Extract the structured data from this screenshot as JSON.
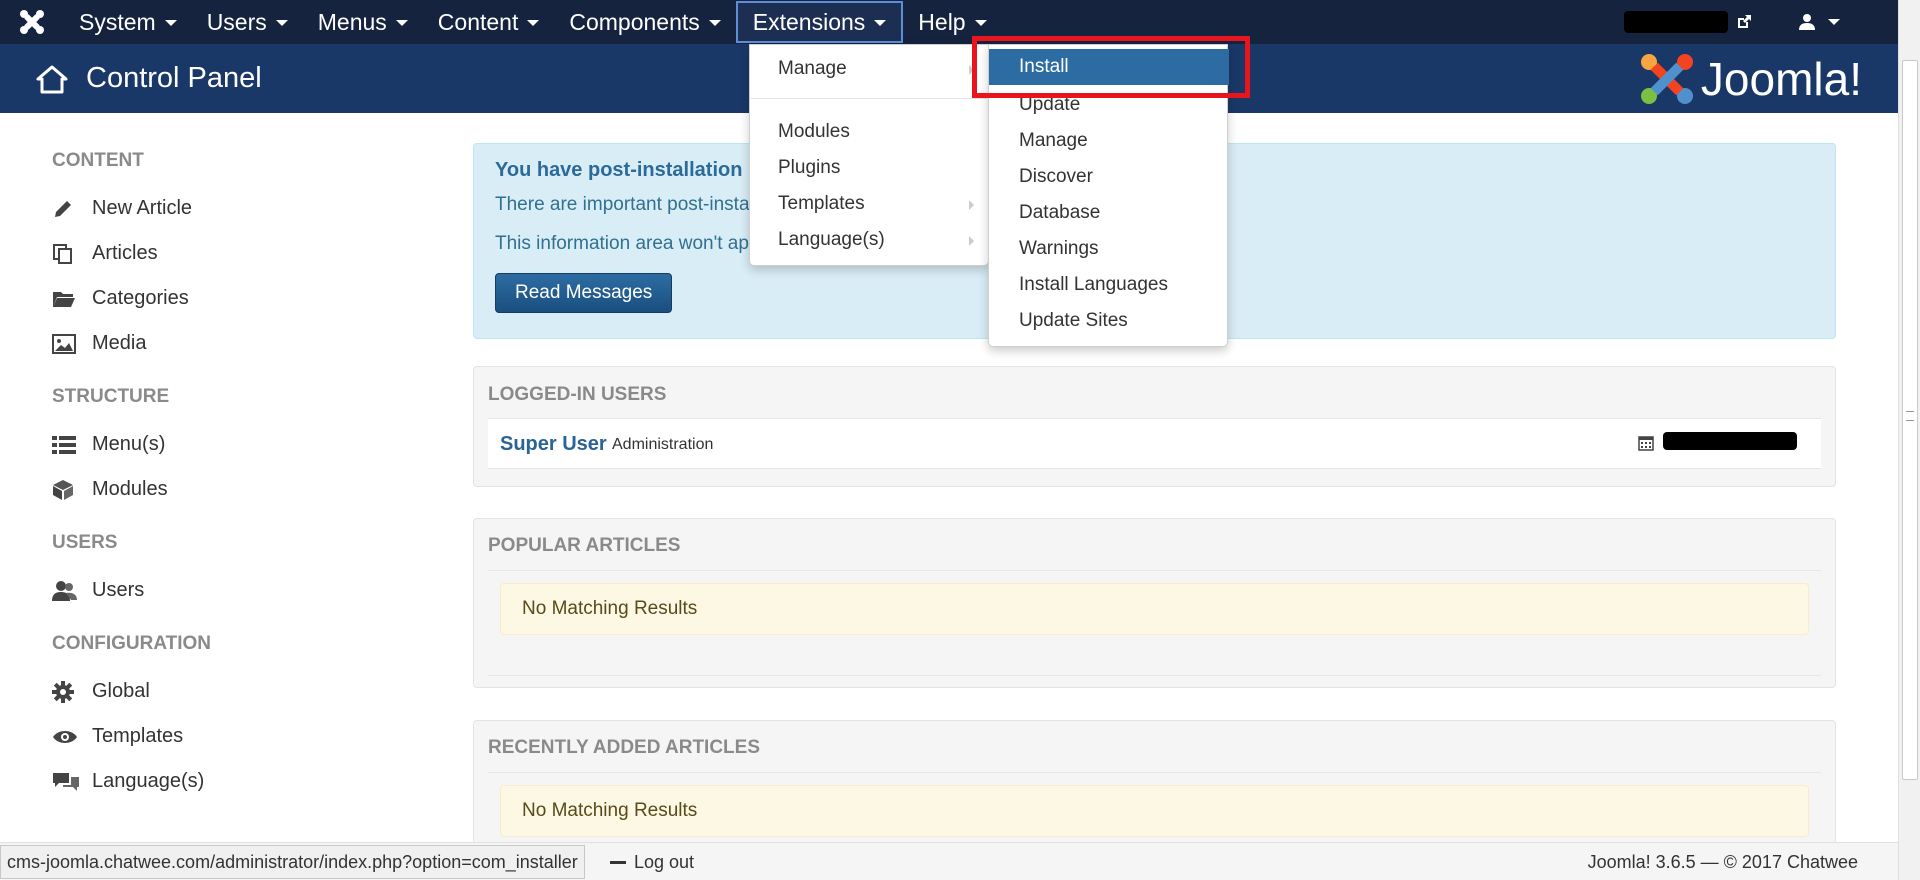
{
  "navbar": {
    "items": [
      {
        "label": "System"
      },
      {
        "label": "Users"
      },
      {
        "label": "Menus"
      },
      {
        "label": "Content"
      },
      {
        "label": "Components"
      },
      {
        "label": "Extensions"
      },
      {
        "label": "Help"
      }
    ],
    "active_item": "Extensions",
    "user_icon": "user-icon",
    "external_link_icon": "external-link-icon"
  },
  "header": {
    "title": "Control Panel",
    "brand": "Joomla!",
    "home_icon": "home-icon"
  },
  "extensions_menu": {
    "items": [
      {
        "label": "Manage",
        "has_submenu": true
      },
      {
        "label": "Modules",
        "has_submenu": false
      },
      {
        "label": "Plugins",
        "has_submenu": false
      },
      {
        "label": "Templates",
        "has_submenu": true
      },
      {
        "label": "Language(s)",
        "has_submenu": true
      }
    ]
  },
  "manage_submenu": {
    "items": [
      {
        "label": "Install",
        "active": true
      },
      {
        "label": "Update"
      },
      {
        "label": "Manage"
      },
      {
        "label": "Discover"
      },
      {
        "label": "Database"
      },
      {
        "label": "Warnings"
      },
      {
        "label": "Install Languages"
      },
      {
        "label": "Update Sites"
      }
    ]
  },
  "sidebar": {
    "groups": [
      {
        "heading": "CONTENT",
        "items": [
          {
            "label": "New Article",
            "icon": "pencil-icon"
          },
          {
            "label": "Articles",
            "icon": "copy-icon"
          },
          {
            "label": "Categories",
            "icon": "folder-icon"
          },
          {
            "label": "Media",
            "icon": "image-icon"
          }
        ]
      },
      {
        "heading": "STRUCTURE",
        "items": [
          {
            "label": "Menu(s)",
            "icon": "list-icon"
          },
          {
            "label": "Modules",
            "icon": "cube-icon"
          }
        ]
      },
      {
        "heading": "USERS",
        "items": [
          {
            "label": "Users",
            "icon": "users-icon"
          }
        ]
      },
      {
        "heading": "CONFIGURATION",
        "items": [
          {
            "label": "Global",
            "icon": "gear-icon"
          },
          {
            "label": "Templates",
            "icon": "eye-icon"
          },
          {
            "label": "Language(s)",
            "icon": "comments-icon"
          }
        ]
      }
    ]
  },
  "alert": {
    "title": "You have post-installation",
    "line1": "There are important post-insta",
    "line2": "This information area won't ap",
    "button": "Read Messages"
  },
  "logged_in_users": {
    "title": "LOGGED-IN USERS",
    "user_name": "Super User",
    "user_role": "Administration",
    "calendar_icon": "calendar-icon"
  },
  "popular_articles": {
    "title": "POPULAR ARTICLES",
    "empty_text": "No Matching Results"
  },
  "recent_articles": {
    "title": "RECENTLY ADDED ARTICLES",
    "empty_text": "No Matching Results"
  },
  "statusbar": {
    "url": "cms-joomla.chatwee.com/administrator/index.php?option=com_installer",
    "logout": "Log out",
    "footer": "Joomla! 3.6.5  —  © 2017 Chatwee"
  },
  "colors": {
    "navbar_bg": "#15233f",
    "header_bg": "#1a3867",
    "active_menu": "#2d6ca2",
    "highlight": "#e8161c"
  }
}
